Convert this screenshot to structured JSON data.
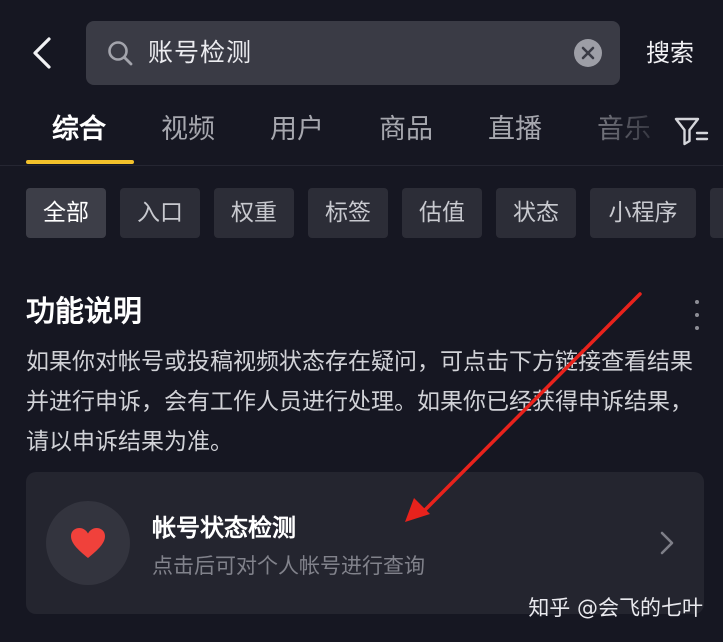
{
  "header": {
    "back_icon": "chevron-left-icon",
    "search_value": "账号检测",
    "search_icon": "search-icon",
    "clear_icon": "clear-icon",
    "search_button": "搜索"
  },
  "tabs": [
    {
      "label": "综合",
      "active": true
    },
    {
      "label": "视频"
    },
    {
      "label": "用户"
    },
    {
      "label": "商品"
    },
    {
      "label": "直播"
    },
    {
      "label": "音乐"
    }
  ],
  "filter_icon": "filter-icon",
  "chips": [
    {
      "label": "全部",
      "active": true
    },
    {
      "label": "入口"
    },
    {
      "label": "权重"
    },
    {
      "label": "标签"
    },
    {
      "label": "估值"
    },
    {
      "label": "状态"
    },
    {
      "label": "小程序"
    }
  ],
  "section": {
    "title": "功能说明",
    "description": "如果你对帐号或投稿视频状态存在疑问，可点击下方链接查看结果并进行申诉，会有工作人员进行处理。如果你已经获得申诉结果，请以申诉结果为准。"
  },
  "card": {
    "icon": "heart-icon",
    "title": "帐号状态检测",
    "subtitle": "点击后可对个人帐号进行查询"
  },
  "watermark": "知乎 @会飞的七叶",
  "colors": {
    "background": "#161722",
    "accent": "#f3c12b",
    "heart": "#f0413b",
    "annotation_arrow": "#e8221c"
  }
}
